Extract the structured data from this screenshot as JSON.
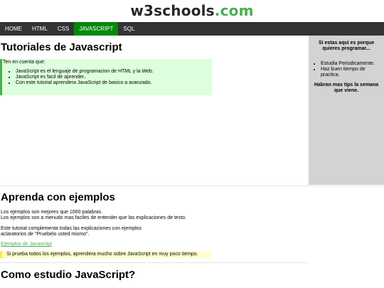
{
  "logo": {
    "part1": "w3schools",
    "part2": ".com"
  },
  "nav": {
    "items": [
      {
        "label": "HOME"
      },
      {
        "label": "HTML"
      },
      {
        "label": "CSS"
      },
      {
        "label": "JAVASCRIPT"
      },
      {
        "label": "SQL"
      }
    ],
    "active_index": 3,
    "active_color": "#04880c",
    "bar_color": "#333333"
  },
  "main": {
    "title": "Tutoriales de Javascript",
    "note": {
      "intro": "Ten en cuenta que:",
      "items": [
        "JavaScript es el lenguaje de programacion de HTML y la Web.",
        "JavaScript es facil de aprender..",
        "Con este tutorial aprendera JavaScript de basico a avanzado."
      ]
    }
  },
  "sidebar": {
    "title": "Si estas aqui es porque quieres programar...",
    "items": [
      "Estudia Periodicamente.",
      "Haz buen tiempo de practica."
    ],
    "footer": "Habran mas tips la semana que viene."
  },
  "section2": {
    "title": "Aprenda con ejemplos",
    "para1_line1": "Los ejemplos son mejores que 1000 palabras.",
    "para1_line2": "Los ejemplos son a menudo mas faciles de entender que las explicaciones de texto.",
    "para2_line1": "Este tutorial complementa todas las explicaciones con ejemplos",
    "para2_line2": "aclaratorios de \"Pruebelo usted mismo\".",
    "link": "Ejemplos de Javascript",
    "tip": "Si prueba todos los ejemplos, aprendera mucho sobre JavaScript en muy poco tiempo."
  },
  "section3": {
    "title": "Como estudio JavaScript?"
  },
  "colors": {
    "accent_green": "#4caf50",
    "note_bg": "#ddffdd",
    "tip_bg": "#ffffcc",
    "tip_border": "#ffeb3b",
    "sidebar_bg": "#d3d3d3"
  }
}
